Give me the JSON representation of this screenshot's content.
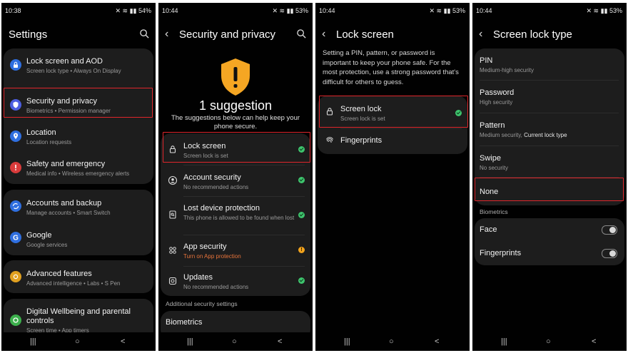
{
  "status_bars": [
    {
      "time": "10:38",
      "battery": "54%"
    },
    {
      "time": "10:44",
      "battery": "53%"
    },
    {
      "time": "10:44",
      "battery": "53%"
    },
    {
      "time": "10:44",
      "battery": "53%"
    }
  ],
  "settings": {
    "title": "Settings",
    "items": [
      {
        "label": "Lock screen and AOD",
        "sub": "Screen lock type  •  Always On Display",
        "color": "#2f6fe0"
      },
      {
        "label": "Security and privacy",
        "sub": "Biometrics  •  Permission manager",
        "color": "#4c5ee0"
      },
      {
        "label": "Location",
        "sub": "Location requests",
        "color": "#2f6fe0"
      },
      {
        "label": "Safety and emergency",
        "sub": "Medical info  •  Wireless emergency alerts",
        "color": "#d93b3b"
      },
      {
        "label": "Accounts and backup",
        "sub": "Manage accounts  •  Smart Switch",
        "color": "#2f6fe0"
      },
      {
        "label": "Google",
        "sub": "Google services",
        "color": "#2f6fe0"
      },
      {
        "label": "Advanced features",
        "sub": "Advanced intelligence  •  Labs  •  S Pen",
        "color": "#e0a020"
      },
      {
        "label": "Digital Wellbeing and parental controls",
        "sub": "Screen time  •  App timers",
        "color": "#3cb04c"
      }
    ]
  },
  "security": {
    "title": "Security and privacy",
    "headline": "1 suggestion",
    "description": "The suggestions below can help keep your phone secure.",
    "items": [
      {
        "label": "Lock screen",
        "sub": "Screen lock is set"
      },
      {
        "label": "Account security",
        "sub": "No recommended actions"
      },
      {
        "label": "Lost device protection",
        "sub": "This phone is allowed to be found when lost"
      },
      {
        "label": "App security",
        "sub": "Turn on App protection"
      },
      {
        "label": "Updates",
        "sub": "No recommended actions"
      }
    ],
    "additional_header": "Additional security settings",
    "biometrics_label": "Biometrics"
  },
  "lockscreen": {
    "title": "Lock screen",
    "info": "Setting a PIN, pattern, or password is important to keep your phone safe. For the most protection, use a strong password that's difficult for others to guess.",
    "screen_lock_label": "Screen lock",
    "screen_lock_sub": "Screen lock is set",
    "fingerprints_label": "Fingerprints"
  },
  "locktype": {
    "title": "Screen lock type",
    "options": [
      {
        "label": "PIN",
        "sub": "Medium-high security"
      },
      {
        "label": "Password",
        "sub": "High security"
      },
      {
        "label": "Pattern",
        "sub": "Medium security, ",
        "sub_bold": "Current lock type"
      },
      {
        "label": "Swipe",
        "sub": "No security"
      },
      {
        "label": "None",
        "sub": ""
      }
    ],
    "biometrics_header": "Biometrics",
    "face_label": "Face",
    "fingerprints_label": "Fingerprints",
    "face_toggle": "off",
    "fingerprints_toggle": "off"
  },
  "nav": {
    "recents": "|||",
    "home": "○",
    "back": "<"
  }
}
